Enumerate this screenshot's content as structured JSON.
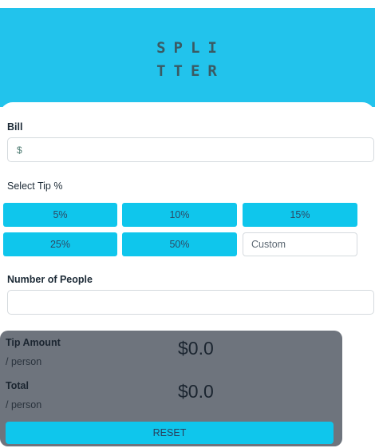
{
  "app": {
    "logo_line1": "SPLI",
    "logo_line2": "TTER"
  },
  "bill": {
    "label": "Bill",
    "currency_symbol": "$",
    "value": ""
  },
  "tip": {
    "label": "Select Tip %",
    "options": [
      "5%",
      "10%",
      "15%",
      "25%",
      "50%"
    ],
    "custom_placeholder": "Custom"
  },
  "people": {
    "label": "Number of People",
    "value": ""
  },
  "results": {
    "tip_amount_label": "Tip Amount",
    "tip_amount_sub": "/ person",
    "tip_amount_value": "$0.0",
    "total_label": "Total",
    "total_sub": "/ person",
    "total_value": "$0.0",
    "reset_label": "RESET"
  },
  "colors": {
    "header_bg": "#22c3ec",
    "accent": "#0fc6ec",
    "results_bg": "#6e747d"
  }
}
